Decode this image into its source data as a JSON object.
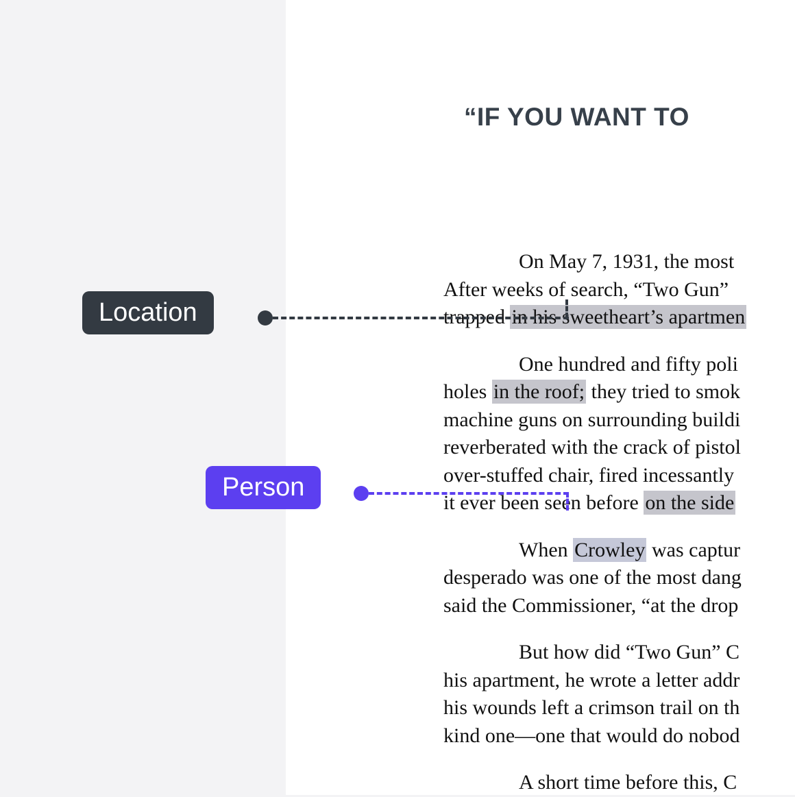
{
  "tags": {
    "location": {
      "label": "Location",
      "color": "#333a42"
    },
    "person": {
      "label": "Person",
      "color": "#5c3ff0"
    }
  },
  "document": {
    "title": "“IF YOU WANT TO",
    "paragraphs": {
      "p1": {
        "pre": "On May 7, 1931, the most ",
        "line2_pre": "After weeks of search, “Two Gun” ",
        "line3_pre": "trapped ",
        "hl1": "in his sweetheart’s apartmen"
      },
      "p2": {
        "pre": "One hundred and fifty poli",
        "line2_pre": "holes ",
        "hl1": "in the roof;",
        "line2_post": " they tried to smok",
        "line3": "machine guns on surrounding buildi",
        "line4": "reverberated with the crack of pistol",
        "line5": "over-stuffed chair, fired incessantly ",
        "line6_pre": "it ever been seen before ",
        "hl2": "on the side"
      },
      "p3": {
        "pre": "When ",
        "hl1": "Crowley",
        "post": " was captur",
        "line2": "desperado was one of the most dang",
        "line3": "said the Commissioner, “at the drop"
      },
      "p4": {
        "pre": "But how did “Two Gun” C",
        "line2": "his apartment, he wrote a letter addr",
        "line3": "his wounds left a crimson trail on th",
        "line4": "kind one—one that would do nobod"
      },
      "p5": {
        "pre": "A short time before this, C"
      }
    }
  }
}
